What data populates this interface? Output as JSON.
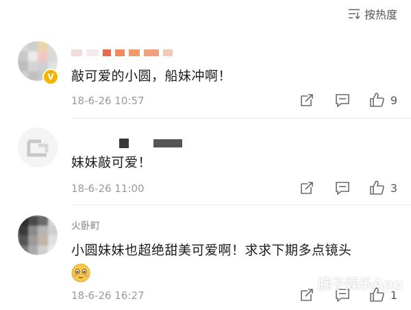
{
  "header": {
    "sort_label": "按热度"
  },
  "comments": [
    {
      "text": "敲可爱的小圆，船妹冲啊！",
      "time": "18-6-26 10:57",
      "likes": "9"
    },
    {
      "text": "妹妹敲可爱！",
      "time": "18-6-26 11:00",
      "likes": "3"
    },
    {
      "text": "小圆妹妹也超绝甜美可爱啊！求求下期多点镜头",
      "time": "18-6-26 16:27",
      "likes": "1",
      "name_fragment": "火卧町"
    }
  ],
  "watermark": "腕子娱乐App",
  "colors": {
    "badge": "#f5b400",
    "muted": "#9a9a9a"
  }
}
